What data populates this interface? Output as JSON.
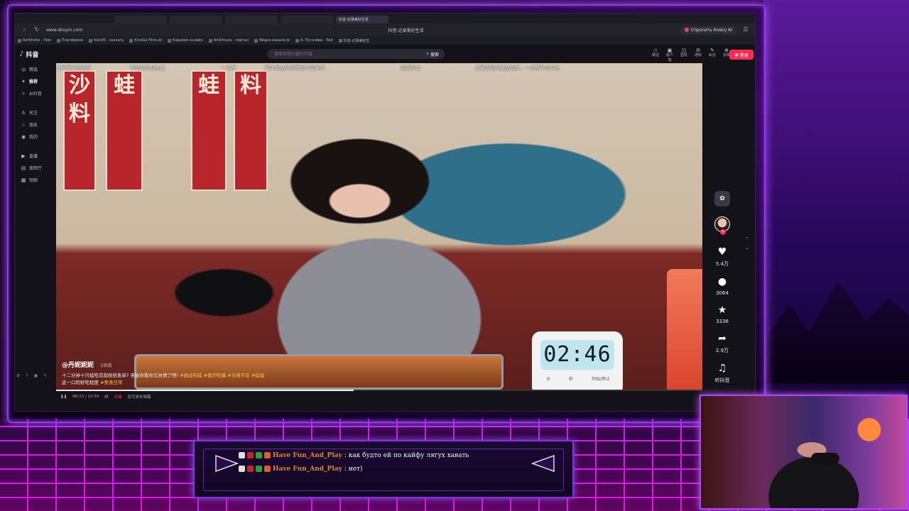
{
  "browser": {
    "tabs": [
      "",
      "",
      "",
      "",
      "抖音-记录美好生活"
    ],
    "url": "www.douyin.com",
    "title": "抖音-记录美好生活",
    "alisa": "Спросить Алису AI",
    "bookmarks": [
      "ReYohoho - Пом",
      "Платформа",
      "KissVK - скачать",
      "KinoGo-Films.bi",
      "Караоке онлайн",
      "AmDmuzu - портал",
      "Видео канала Je",
      "А. Пугачёва - Зей",
      "抖音-记录美好生"
    ]
  },
  "douyin": {
    "logo": "抖音",
    "search": {
      "placeholder": "搜索你感兴趣的内容",
      "button": "搜索"
    },
    "top_icons": [
      {
        "glyph": "◇",
        "label": "精选"
      },
      {
        "glyph": "▣",
        "label": "客户端"
      },
      {
        "glyph": "◫",
        "label": "壁纸"
      },
      {
        "glyph": "✉",
        "label": "通知"
      },
      {
        "glyph": "✎",
        "label": "私信"
      },
      {
        "glyph": "⊕",
        "label": "投稿"
      }
    ],
    "login": "登录",
    "sidebar": [
      {
        "icon": "◎",
        "label": "精选",
        "active": false
      },
      {
        "icon": "✦",
        "label": "推荐",
        "active": true
      },
      {
        "icon": "✧",
        "label": "AI抖音",
        "active": false
      },
      {
        "icon": "♙",
        "label": "关注",
        "active": false
      },
      {
        "icon": "♧",
        "label": "朋友",
        "active": false
      },
      {
        "icon": "◉",
        "label": "我的",
        "active": false
      },
      {
        "icon": "▶",
        "label": "直播",
        "active": false
      },
      {
        "icon": "▤",
        "label": "放映厅",
        "active": false
      },
      {
        "icon": "▦",
        "label": "短剧",
        "active": false
      }
    ],
    "captions": [
      "三种辣椒的老婆",
      "不想吃行业吐槽",
      "一分辣",
      "最牛的是只跟辣的不留鼻涕",
      "毫无压力",
      "这家店玩的就是真实，一点都不会打扰"
    ],
    "video": {
      "timer": "02:46",
      "timer_labels": [
        "分",
        "秒",
        "开始/停止"
      ],
      "author": "@丹妮妮妮",
      "age": "· 5天前",
      "desc_line1": "十二分钟十只蛙吃完就统统免单? 老板你看你又丝情了吧!",
      "tags1": "#挑战吃蛙 #我的吃播 #无辣不欢 #蛙蛙",
      "desc_line2": "这一口的好吃程度",
      "tags2": "#美食日常",
      "progress": 0.46
    },
    "rail": {
      "likes": "5.4万",
      "comments": "3064",
      "favorites": "3336",
      "shares": "2.9万",
      "listen": "听抖音"
    },
    "controls": {
      "time": "06:23 / 13:34",
      "connect": "连播",
      "hint": "后可发布弹幕"
    }
  },
  "chat": {
    "messages": [
      {
        "user": "Have Fun_And_Play",
        "text": ": как будто ей по кайфу лягух хавать"
      },
      {
        "user": "Have Fun_And_Play",
        "text": ": нет)"
      }
    ]
  },
  "colors": {
    "accent": "#fe2c55",
    "neon": "#b045ff",
    "chat_user": "#e08a1e"
  }
}
